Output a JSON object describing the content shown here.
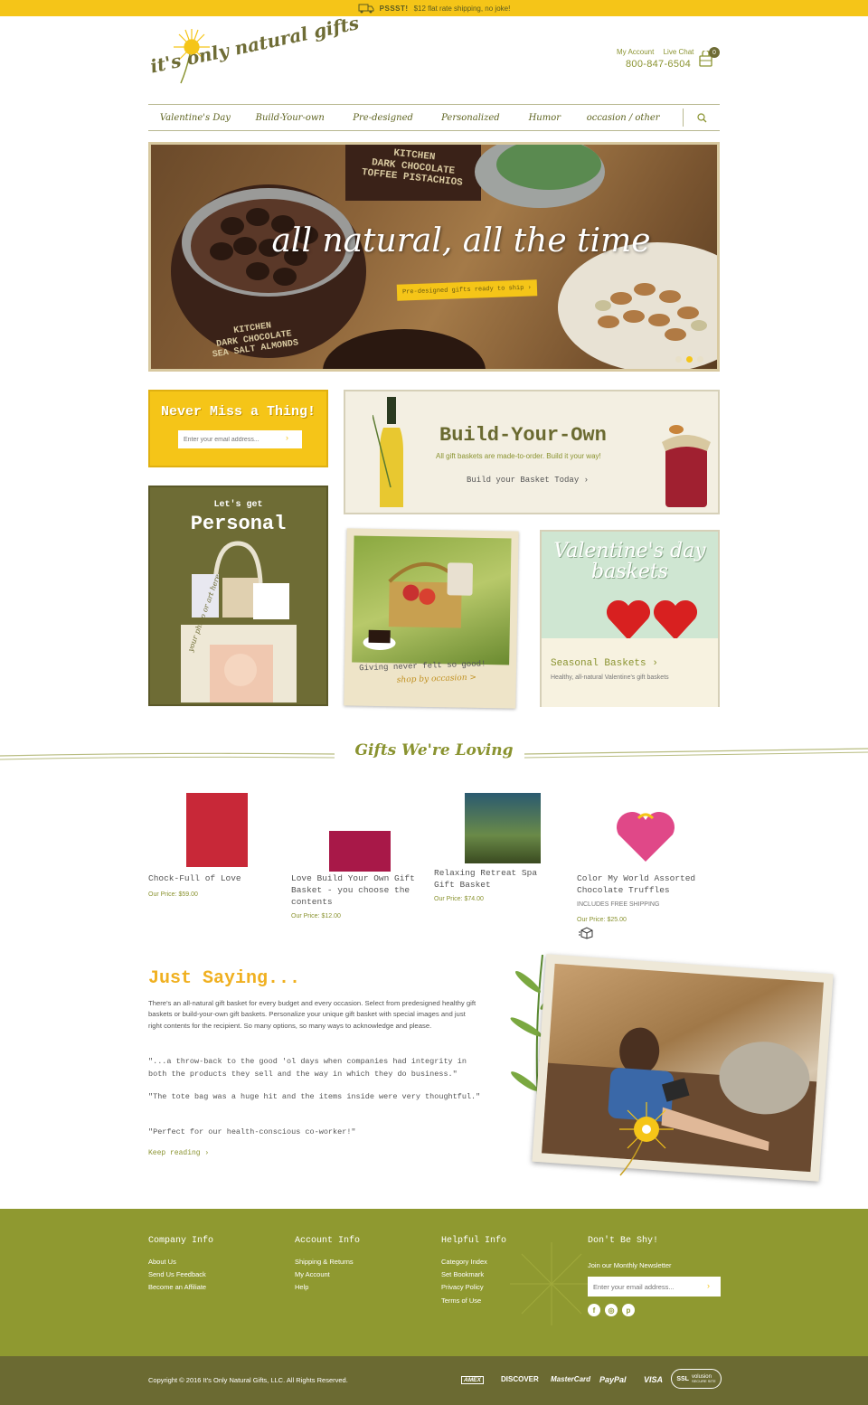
{
  "promo": {
    "label": "PSSST!",
    "text": "$12 flat rate shipping, no joke!"
  },
  "header": {
    "logo_text": "it's only natural gifts",
    "my_account": "My Account",
    "live_chat": "Live Chat",
    "phone": "800-847-6504",
    "cart_count": "0"
  },
  "nav": {
    "items": [
      "Valentine's Day",
      "Build-Your-own",
      "Pre-designed",
      "Personalized",
      "Humor",
      "occasion / other"
    ]
  },
  "hero": {
    "title": "all natural, all the time",
    "cta": "Pre-designed gifts ready to ship ›",
    "tin1_line1": "KITCHEN",
    "tin1_line2": "DARK CHOCOLATE",
    "tin1_line3": "TOFFEE PISTACHIOS",
    "tin2_line1": "KITCHEN",
    "tin2_line2": "DARK CHOCOLATE",
    "tin2_line3": "SEA SALT ALMONDS"
  },
  "newsletter_promo": {
    "title": "Never Miss a Thing!",
    "placeholder": "Enter your email address..."
  },
  "build_own": {
    "title": "Build-Your-Own",
    "subtitle": "All gift baskets are made-to-order. Build it your way!",
    "cta": "Build your Basket Today ›"
  },
  "personal": {
    "top": "Let's get",
    "main": "Personal",
    "tote_text": "your photo or art here"
  },
  "occasion": {
    "line1": "Giving never felt so good!",
    "line2": "shop by occasion >"
  },
  "valentine": {
    "title_line1": "Valentine's day",
    "title_line2": "baskets",
    "cta": "Seasonal Baskets ›",
    "sub": "Healthy, all-natural Valentine's gift baskets"
  },
  "gifts_heading": "Gifts We're Loving",
  "products": [
    {
      "name": "Chock-Full of Love",
      "price": "Our Price: $59.00",
      "note": ""
    },
    {
      "name": "Love Build Your Own Gift Basket - you choose the contents",
      "price": "Our Price: $12.00",
      "note": ""
    },
    {
      "name": "Relaxing Retreat Spa Gift Basket",
      "price": "Our Price: $74.00",
      "note": ""
    },
    {
      "name": "Color My World Assorted Chocolate Truffles",
      "price": "Our Price: $25.00",
      "note": "INCLUDES FREE SHIPPING"
    }
  ],
  "just_saying": {
    "title": "Just Saying...",
    "body": "There's an all-natural gift basket for every budget and every occasion. Select from predesigned healthy gift baskets or build-your-own gift baskets. Personalize your unique gift basket with special images and just right contents for the recipient. So many options, so many ways to acknowledge and please.",
    "quotes": [
      "\"...a throw-back to the good 'ol days when companies had integrity in both the products they sell and the way in which they do business.\"",
      "\"The tote bag was a huge hit and the items inside were very thoughtful.\"",
      "\"Perfect for our health-conscious co-worker!\""
    ],
    "more": "Keep reading ›"
  },
  "footer": {
    "company": {
      "title": "Company Info",
      "links": [
        "About Us",
        "Send Us Feedback",
        "Become an Affiliate"
      ]
    },
    "account": {
      "title": "Account Info",
      "links": [
        "Shipping & Returns",
        "My Account",
        "Help"
      ]
    },
    "helpful": {
      "title": "Helpful Info",
      "links": [
        "Category Index",
        "Set Bookmark",
        "Privacy Policy",
        "Terms of Use"
      ]
    },
    "newsletter": {
      "title": "Don't Be Shy!",
      "sub": "Join our Monthly Newsletter",
      "placeholder": "Enter your email address..."
    },
    "social": [
      "f",
      "◎",
      "p"
    ],
    "copyright": "Copyright © 2016 It's Only Natural Gifts, LLC. All Rights Reserved.",
    "payments": [
      "AMEX",
      "DISCOVER",
      "MasterCard",
      "PayPal",
      "VISA"
    ],
    "ssl": "SSL",
    "ssl_brand": "volusion",
    "ssl_sub": "SECURE SITE"
  },
  "colors": {
    "accent_yellow": "#f5c518",
    "olive": "#8f9930",
    "dark_olive": "#6b6a32"
  }
}
